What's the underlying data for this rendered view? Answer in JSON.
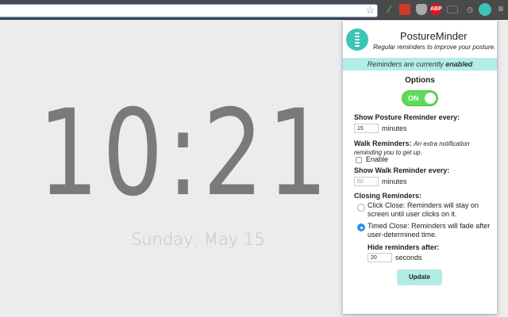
{
  "browser": {
    "extensions": [
      {
        "icon": "eyedropper-icon",
        "color": "#4a8a3a"
      },
      {
        "icon": "book-icon",
        "color": "#d03a2a"
      },
      {
        "icon": "shield-icon",
        "color": "#aaa"
      },
      {
        "icon": "adblock-icon",
        "label": "ABP",
        "color": "#e0161b"
      },
      {
        "icon": "cast-icon",
        "color": "#666"
      },
      {
        "icon": "clock-icon",
        "color": "#888"
      },
      {
        "icon": "posture-minder-icon",
        "color": "#3cc4b5"
      }
    ]
  },
  "page": {
    "time": "10:21",
    "date": "Sunday, May 15"
  },
  "popup": {
    "title": "PostureMinder",
    "subtitle": "Regular reminders to improve your posture.",
    "status_prefix": "Reminders are currently ",
    "status_value": "enabled",
    "options_heading": "Options",
    "toggle_label": "ON",
    "toggle_on": true,
    "posture_label": "Show Posture Reminder every:",
    "posture_value": "15",
    "posture_unit": "minutes",
    "walk_label": "Walk Reminders:",
    "walk_desc": "An extra notification reminding you to get up.",
    "walk_enable_label": "Enable",
    "walk_enabled": false,
    "walk_every_label": "Show Walk Reminder every:",
    "walk_value": "60",
    "walk_unit": "minutes",
    "closing_label": "Closing Reminders:",
    "click_close": "Click Close: Reminders will stay on screen until user clicks on it.",
    "timed_close": "Timed Close: Reminders will fade after user-determined time.",
    "selected": "timed",
    "hide_label": "Hide reminders after:",
    "hide_value": "20",
    "hide_unit": "seconds",
    "update_label": "Update"
  }
}
